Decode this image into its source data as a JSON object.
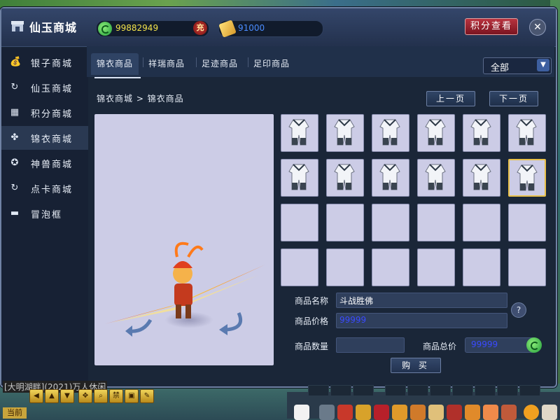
{
  "window": {
    "title": "仙玉商城",
    "silver_amount": "99882949",
    "recharge_badge": "充",
    "points_amount": "91000",
    "points_button": "积分查看",
    "close_symbol": "✕"
  },
  "sidebar": {
    "items": [
      {
        "label": "银子商城",
        "icon": "money-bag-icon"
      },
      {
        "label": "仙玉商城",
        "icon": "jade-swirl-icon"
      },
      {
        "label": "积分商城",
        "icon": "gift-box-icon"
      },
      {
        "label": "锦衣商城",
        "icon": "clover-icon",
        "active": true
      },
      {
        "label": "神兽商城",
        "icon": "beast-icon"
      },
      {
        "label": "点卡商城",
        "icon": "card-swirl-icon"
      },
      {
        "label": "冒泡框",
        "icon": "chat-bubble-icon"
      }
    ]
  },
  "tabs": [
    {
      "label": "锦衣商品",
      "active": true
    },
    {
      "label": "祥瑞商品"
    },
    {
      "label": "足迹商品"
    },
    {
      "label": "足印商品"
    }
  ],
  "filter": {
    "selected": "全部"
  },
  "breadcrumb": "锦衣商城 > 锦衣商品",
  "pager": {
    "prev": "上一页",
    "next": "下一页"
  },
  "grid": {
    "filled_slots": 12,
    "total_slots": 24,
    "selected_index": 11,
    "item_icon": "robe-icon"
  },
  "item_info": {
    "name_label": "商品名称",
    "name_value": "斗战胜佛",
    "price_label": "商品价格",
    "price_value": "99999",
    "qty_label": "商品数量",
    "qty_value": "",
    "total_label": "商品总价",
    "total_value": "99999",
    "help_symbol": "?",
    "buy_label": "购 买"
  },
  "bottom": {
    "chat_text": "[大明湖畔](2021)万人休闲",
    "channel_tag": "当前"
  },
  "colors": {
    "window_bg": "#1a2638",
    "slot_bg": "#cccce6",
    "selected_border": "#e8c04a",
    "silver_text": "#f2e24a",
    "points_text": "#4a8cff",
    "price_text": "#2a3ae8"
  }
}
